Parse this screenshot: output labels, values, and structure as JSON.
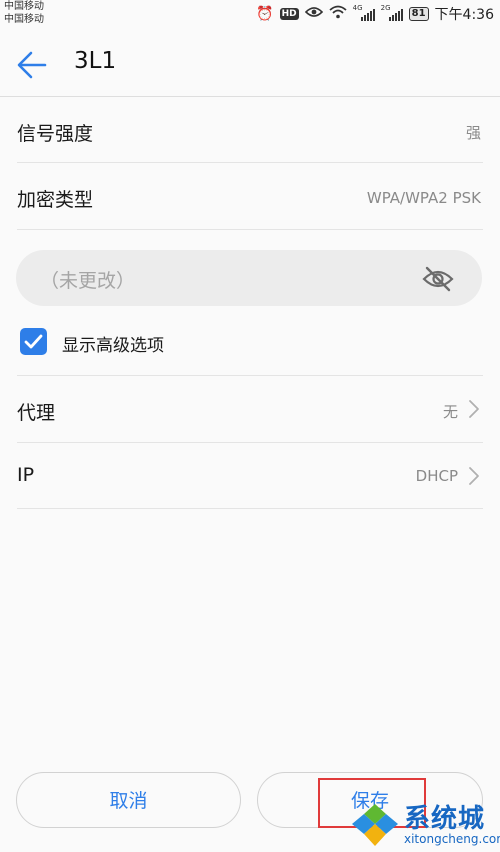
{
  "status_bar": {
    "carrier_1": "中国移动",
    "carrier_2": "中国移动",
    "hd_badge": "HD",
    "net1_tag": "4G",
    "net2_tag": "2G",
    "battery": "81",
    "time": "下午4:36",
    "icons": [
      "alarm-icon",
      "hd-icon",
      "eye-comfort-icon",
      "wifi-icon",
      "signal-icon",
      "signal-icon",
      "battery-icon"
    ]
  },
  "header": {
    "title": "3L1",
    "back_icon": "back-arrow-icon"
  },
  "rows": {
    "signal": {
      "label": "信号强度",
      "value": "强"
    },
    "security": {
      "label": "加密类型",
      "value": "WPA/WPA2 PSK"
    }
  },
  "password": {
    "placeholder": "（未更改）",
    "toggle_icon": "eye-hidden-icon"
  },
  "advanced": {
    "checked": true,
    "label": "显示高级选项"
  },
  "advanced_rows": {
    "proxy": {
      "label": "代理",
      "value": "无"
    },
    "ip": {
      "label": "IP",
      "value": "DHCP"
    }
  },
  "actions": {
    "cancel": "取消",
    "save": "保存"
  },
  "watermark": {
    "text": "系统城",
    "url": "xitongcheng.com"
  },
  "colors": {
    "accent": "#2e7ee8",
    "highlight": "#e03a3a",
    "watermark": "#1767c2"
  }
}
